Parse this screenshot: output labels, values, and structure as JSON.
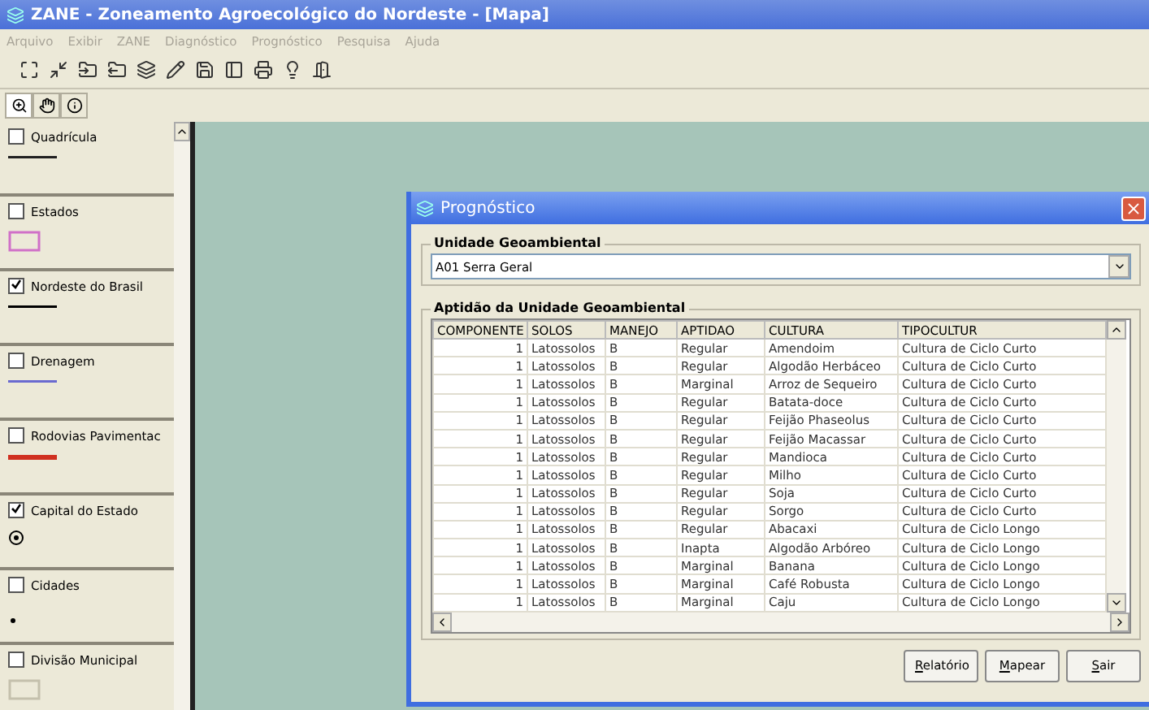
{
  "window": {
    "title": "ZANE - Zoneamento Agroecológico do Nordeste - [Mapa]"
  },
  "menu": [
    {
      "label": "Arquivo",
      "disabled": true
    },
    {
      "label": "Exibir",
      "disabled": true
    },
    {
      "label": "ZANE",
      "disabled": true
    },
    {
      "label": "Diagnóstico",
      "disabled": true
    },
    {
      "label": "Prognóstico",
      "disabled": true
    },
    {
      "label": "Pesquisa",
      "disabled": true
    },
    {
      "label": "Ajuda",
      "disabled": true
    }
  ],
  "layers": [
    {
      "label": "Quadrícula",
      "checked": false,
      "kind": "line",
      "color": "#202020"
    },
    {
      "label": "Estados",
      "checked": false,
      "kind": "box",
      "color": "#d070c8"
    },
    {
      "label": "Nordeste do Brasil",
      "checked": true,
      "kind": "line",
      "color": "#000000"
    },
    {
      "label": "Drenagem",
      "checked": false,
      "kind": "line",
      "color": "#6a6ad0"
    },
    {
      "label": "Rodovias Pavimentac",
      "checked": false,
      "kind": "line",
      "color": "#d03020"
    },
    {
      "label": "Capital do Estado",
      "checked": true,
      "kind": "circle",
      "color": "#000000"
    },
    {
      "label": "Cidades",
      "checked": false,
      "kind": "dot",
      "color": "#000000"
    },
    {
      "label": "Divisão Municipal",
      "checked": false,
      "kind": "box",
      "color": "#c4c0ac"
    }
  ],
  "dialog": {
    "title": "Prognóstico",
    "unit_group": "Unidade Geoambiental",
    "unit_value": "A01 Serra Geral",
    "table_group": "Aptidão da Unidade Geoambiental",
    "columns": [
      "COMPONENTE",
      "SOLOS",
      "MANEJO",
      "APTIDAO",
      "CULTURA",
      "TIPOCULTUR"
    ],
    "rows": [
      [
        "1",
        "Latossolos",
        "B",
        "Regular",
        "Amendoim",
        "Cultura de Ciclo Curto"
      ],
      [
        "1",
        "Latossolos",
        "B",
        "Regular",
        "Algodão Herbáceo",
        "Cultura de Ciclo Curto"
      ],
      [
        "1",
        "Latossolos",
        "B",
        "Marginal",
        "Arroz de Sequeiro",
        "Cultura de Ciclo Curto"
      ],
      [
        "1",
        "Latossolos",
        "B",
        "Regular",
        "Batata-doce",
        "Cultura de Ciclo Curto"
      ],
      [
        "1",
        "Latossolos",
        "B",
        "Regular",
        "Feijão Phaseolus",
        "Cultura de Ciclo Curto"
      ],
      [
        "1",
        "Latossolos",
        "B",
        "Regular",
        "Feijão Macassar",
        "Cultura de Ciclo Curto"
      ],
      [
        "1",
        "Latossolos",
        "B",
        "Regular",
        "Mandioca",
        "Cultura de Ciclo Curto"
      ],
      [
        "1",
        "Latossolos",
        "B",
        "Regular",
        "Milho",
        "Cultura de Ciclo Curto"
      ],
      [
        "1",
        "Latossolos",
        "B",
        "Regular",
        "Soja",
        "Cultura de Ciclo Curto"
      ],
      [
        "1",
        "Latossolos",
        "B",
        "Regular",
        "Sorgo",
        "Cultura de Ciclo Curto"
      ],
      [
        "1",
        "Latossolos",
        "B",
        "Regular",
        "Abacaxi",
        "Cultura de Ciclo Longo"
      ],
      [
        "1",
        "Latossolos",
        "B",
        "Inapta",
        "Algodão Arbóreo",
        "Cultura de Ciclo Longo"
      ],
      [
        "1",
        "Latossolos",
        "B",
        "Marginal",
        "Banana",
        "Cultura de Ciclo Longo"
      ],
      [
        "1",
        "Latossolos",
        "B",
        "Marginal",
        "Café Robusta",
        "Cultura de Ciclo Longo"
      ],
      [
        "1",
        "Latossolos",
        "B",
        "Marginal",
        "Caju",
        "Cultura de Ciclo Longo"
      ]
    ],
    "buttons": [
      "Relatório",
      "Mapear",
      "Sair"
    ]
  }
}
